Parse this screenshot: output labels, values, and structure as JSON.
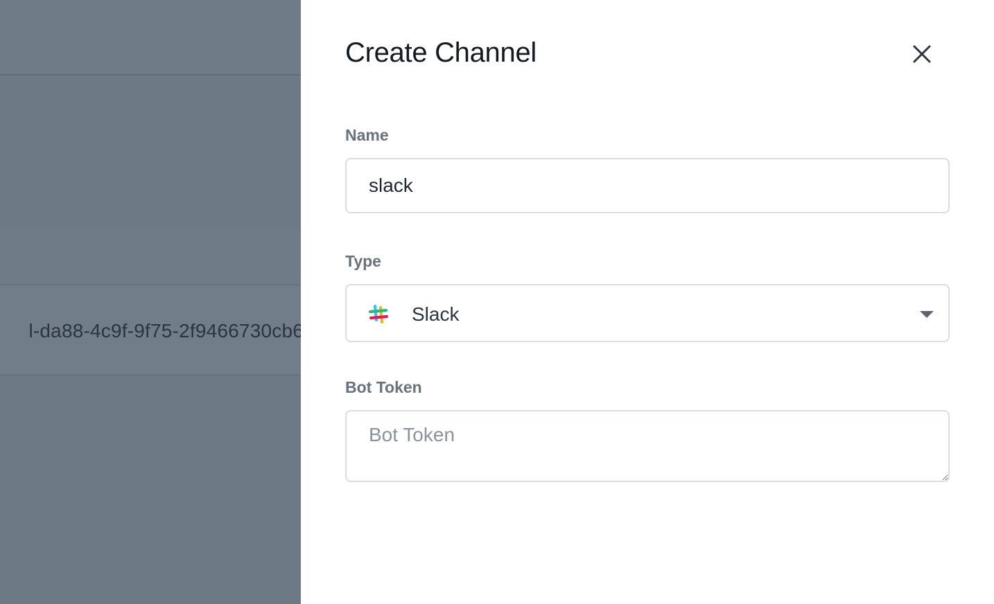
{
  "background": {
    "row_text": "l-da88-4c9f-9f75-2f9466730cb6"
  },
  "drawer": {
    "title": "Create Channel",
    "close_icon": "close-icon",
    "fields": {
      "name": {
        "label": "Name",
        "value": "slack"
      },
      "type": {
        "label": "Type",
        "value": "Slack",
        "icon": "slack-logo-icon"
      },
      "bot_token": {
        "label": "Bot Token",
        "placeholder": "Bot Token",
        "value": ""
      }
    }
  },
  "colors": {
    "backdrop": "#6d7a86",
    "panel": "#ffffff",
    "label": "#67727e",
    "border": "#d9dde2",
    "slack_blue": "#36c5f0",
    "slack_green": "#2eb67d",
    "slack_yellow": "#ecb22e",
    "slack_red": "#e01e5a"
  }
}
